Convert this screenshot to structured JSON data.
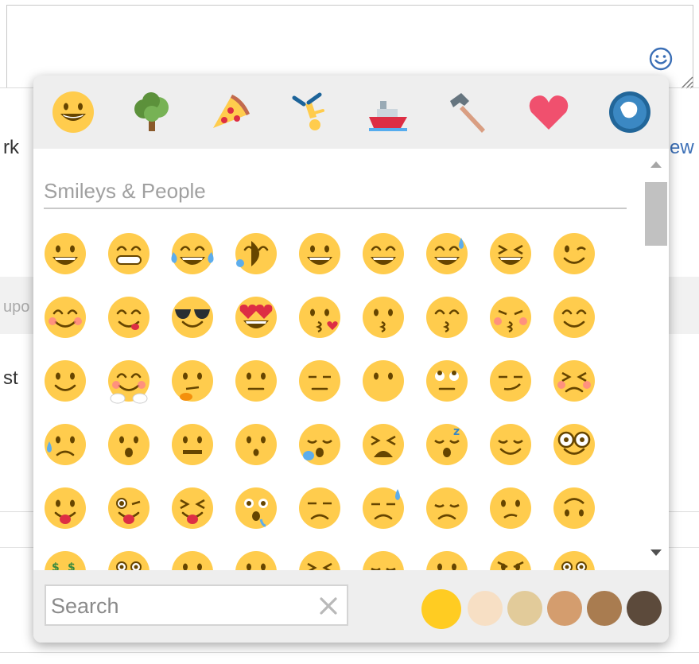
{
  "background": {
    "left_text_1": "rk",
    "left_text_2": "upo",
    "left_text_3": "st",
    "right_link": "ew"
  },
  "editor": {
    "emoji_button_icon": "smiley-face-icon",
    "resize_icon": "resize-grip-icon"
  },
  "picker": {
    "categories": [
      {
        "name": "smileys-people",
        "icon": "grinning-face"
      },
      {
        "name": "animals-nature",
        "icon": "tree"
      },
      {
        "name": "food-drink",
        "icon": "pizza-slice"
      },
      {
        "name": "activity",
        "icon": "person-cartwheeling"
      },
      {
        "name": "travel-places",
        "icon": "ship"
      },
      {
        "name": "objects",
        "icon": "hammer"
      },
      {
        "name": "symbols",
        "icon": "red-heart"
      },
      {
        "name": "flags",
        "icon": "globe"
      }
    ],
    "section_title": "Smileys & People",
    "emoji_rows": [
      [
        "grinning",
        "grin",
        "joy",
        "rofl",
        "smiley",
        "smile",
        "sweat-smile",
        "laughing",
        "wink"
      ],
      [
        "blush",
        "yum",
        "sunglasses",
        "heart-eyes",
        "kissing-heart",
        "kissing",
        "kissing-smiling-eyes",
        "kissing-closed-eyes",
        "relaxed"
      ],
      [
        "slight-smile",
        "hugging",
        "thinking",
        "neutral",
        "expressionless",
        "no-mouth",
        "rolling-eyes",
        "smirk",
        "persevere"
      ],
      [
        "disappointed-relieved",
        "open-mouth",
        "zipper-mouth",
        "hushed",
        "sleepy",
        "tired",
        "sleeping",
        "relieved",
        "nerd"
      ],
      [
        "tongue",
        "stuck-out-tongue-winking-eye",
        "stuck-out-tongue-closed-eyes",
        "drooling",
        "unamused",
        "sweat",
        "pensive",
        "confused",
        "upside-down"
      ],
      [
        "money-mouth",
        "astonished",
        "frowning",
        "frowning-2",
        "confounded",
        "disappointed",
        "worried",
        "angry",
        "flushed"
      ]
    ],
    "search": {
      "placeholder": "Search",
      "value": ""
    },
    "skin_tones": [
      "#ffcc22",
      "#f7dfc4",
      "#e2cb9a",
      "#d49d6e",
      "#a97c50",
      "#5c4a3b"
    ],
    "selected_tone": 0
  }
}
